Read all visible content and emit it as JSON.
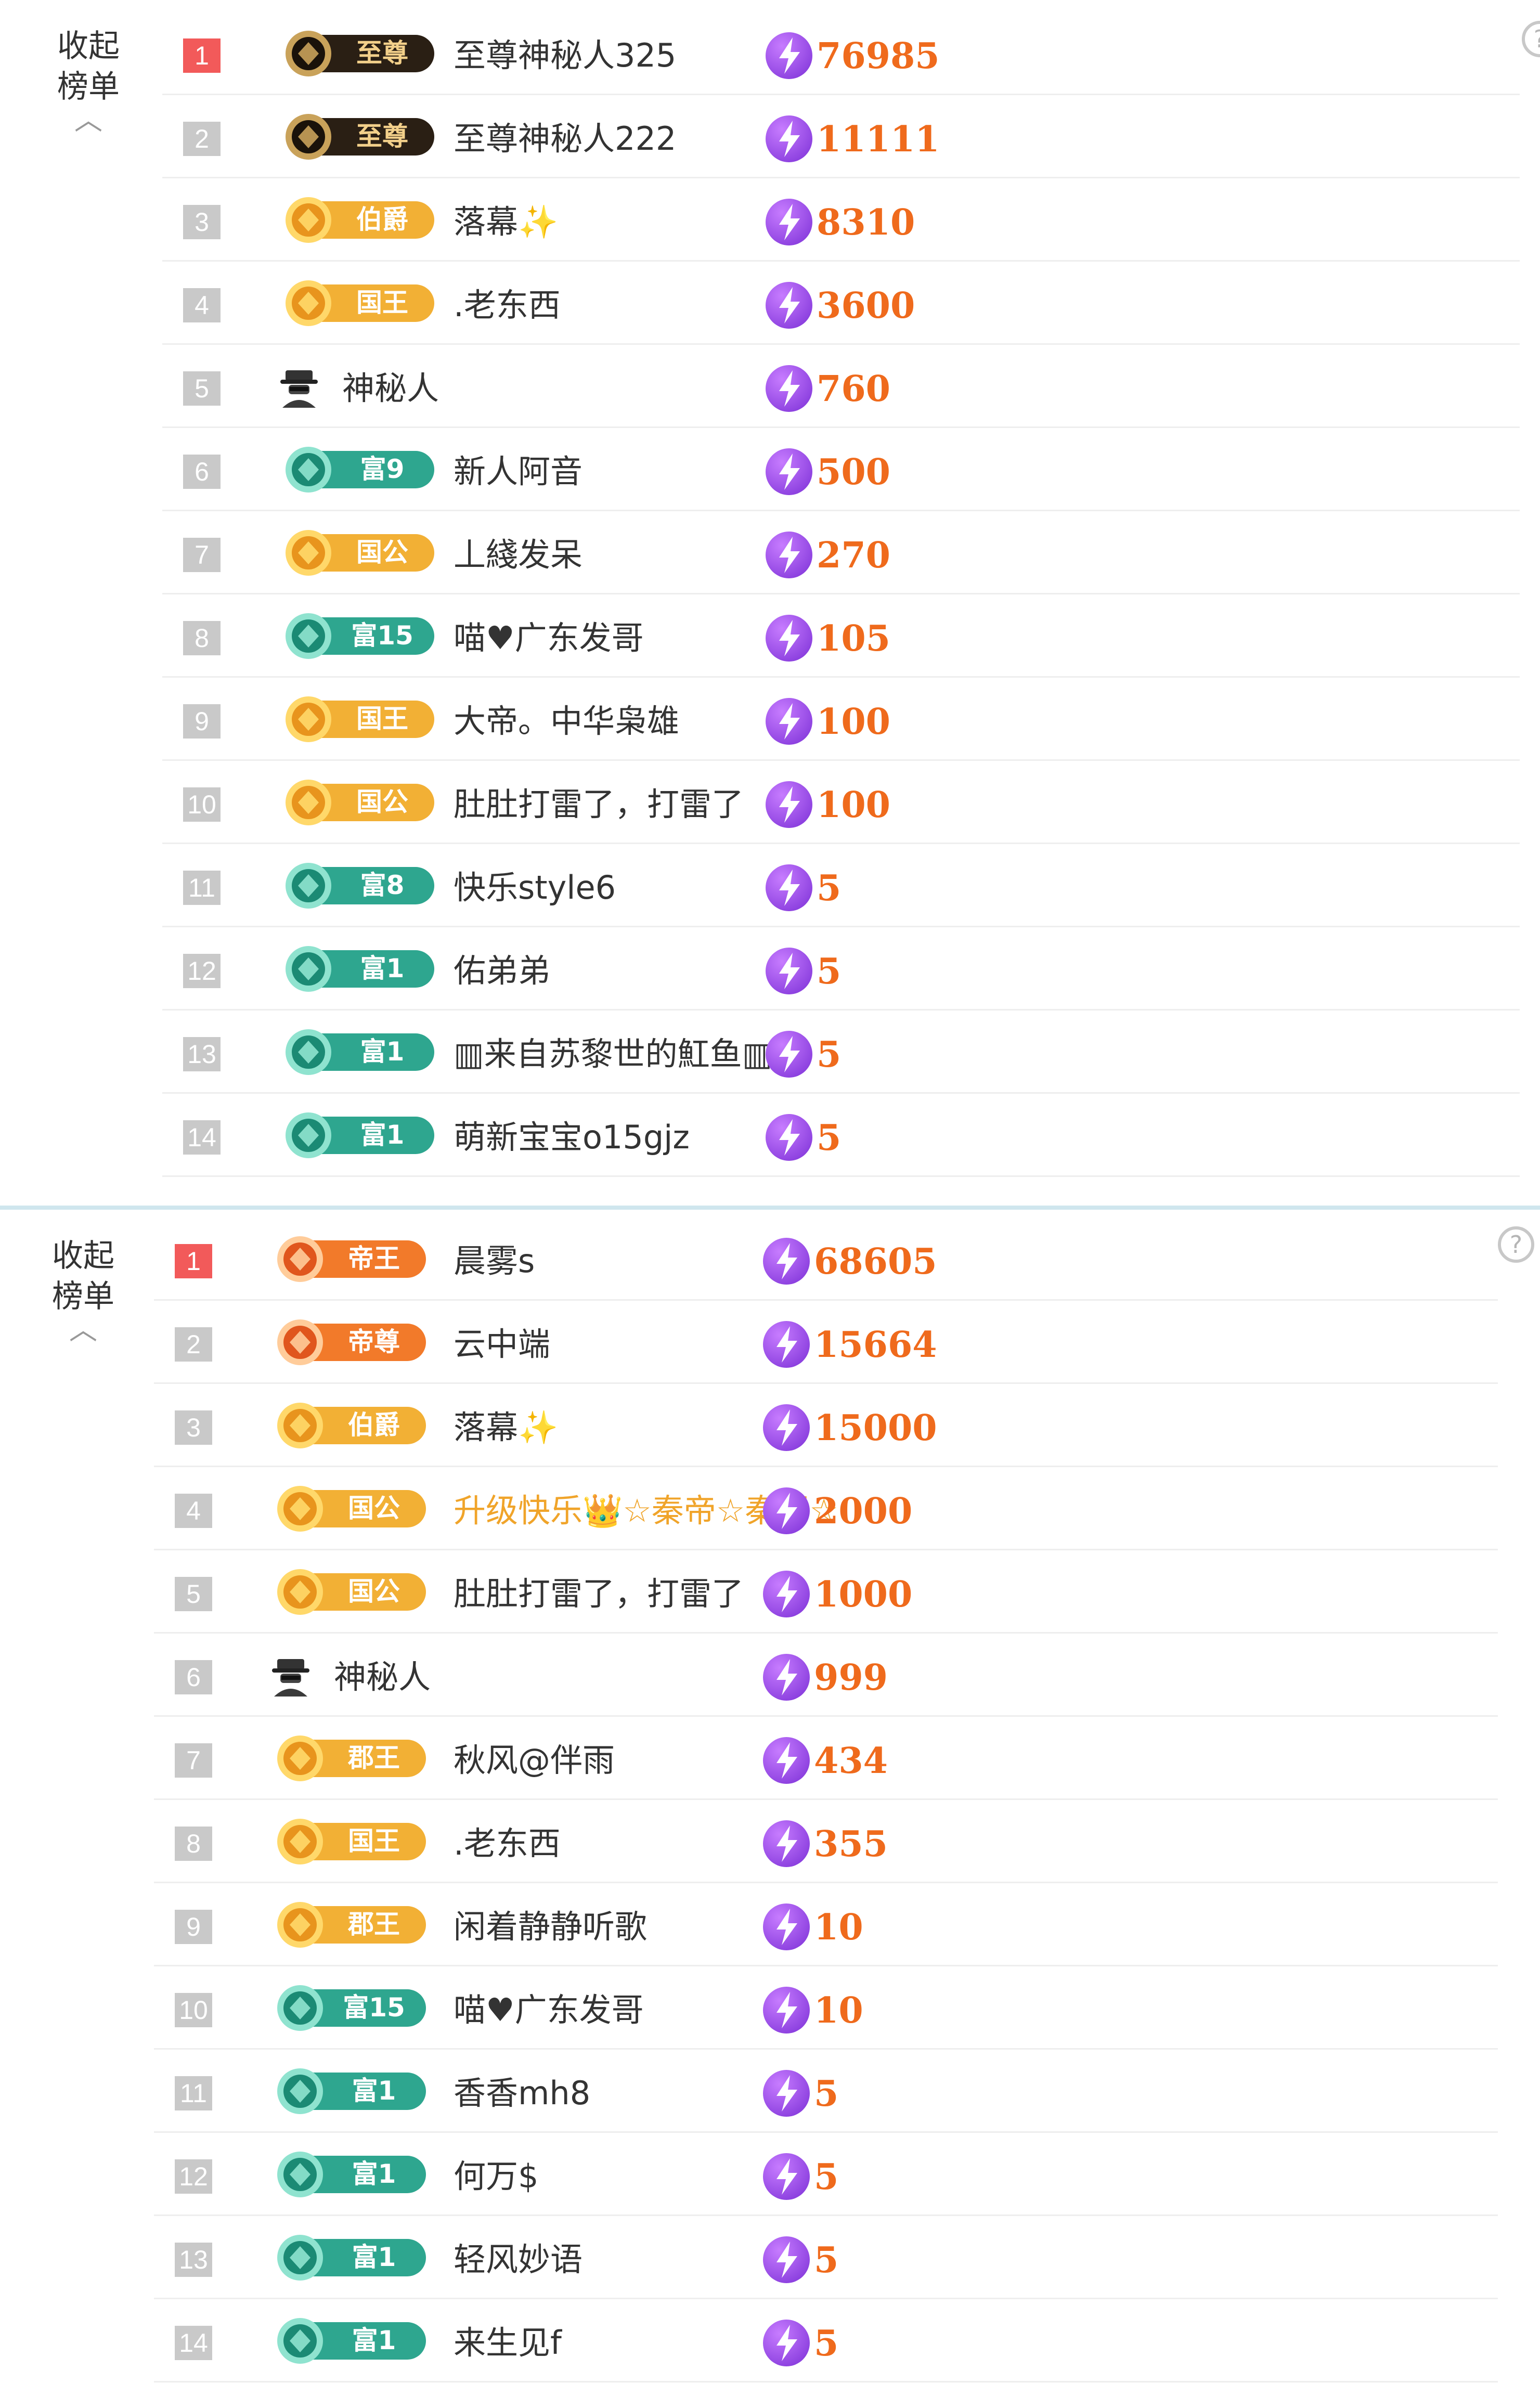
{
  "colors": {
    "accent_score": "#ef6a1c",
    "rank_first": "#f25a5a",
    "rank_other": "#c9c9c9",
    "gold_name": "#f0a42a",
    "separator": "#cfe6ee"
  },
  "panels": [
    {
      "collapse_label": "收起\n榜单",
      "rows": [
        {
          "rank": "1",
          "medal": "至尊",
          "medal_type": "supreme",
          "name": "至尊神秘人325",
          "score": "76985"
        },
        {
          "rank": "2",
          "medal": "至尊",
          "medal_type": "supreme",
          "name": "至尊神秘人222",
          "score": "11111"
        },
        {
          "rank": "3",
          "medal": "伯爵",
          "medal_type": "gold",
          "name": "落幕✨",
          "score": "8310"
        },
        {
          "rank": "4",
          "medal": "国王",
          "medal_type": "gold",
          "name": ".老东西",
          "score": "3600"
        },
        {
          "rank": "5",
          "medal": "",
          "medal_type": "mystery",
          "name": "神秘人",
          "score": "760"
        },
        {
          "rank": "6",
          "medal": "富9",
          "medal_type": "green",
          "name": "新人阿音",
          "score": "500"
        },
        {
          "rank": "7",
          "medal": "国公",
          "medal_type": "gold",
          "name": "丄綫发呆",
          "score": "270"
        },
        {
          "rank": "8",
          "medal": "富15",
          "medal_type": "green",
          "name": "喵♥广东发哥",
          "score": "105"
        },
        {
          "rank": "9",
          "medal": "国王",
          "medal_type": "gold",
          "name": "大帝。中华枭雄",
          "score": "100"
        },
        {
          "rank": "10",
          "medal": "国公",
          "medal_type": "gold",
          "name": "肚肚打雷了，打雷了",
          "score": "100"
        },
        {
          "rank": "11",
          "medal": "富8",
          "medal_type": "green",
          "name": "快乐style6",
          "score": "5"
        },
        {
          "rank": "12",
          "medal": "富1",
          "medal_type": "green",
          "name": "佑弟弟",
          "score": "5"
        },
        {
          "rank": "13",
          "medal": "富1",
          "medal_type": "green",
          "name": "▥来自苏黎世的魟鱼▥",
          "score": "5"
        },
        {
          "rank": "14",
          "medal": "富1",
          "medal_type": "green",
          "name": "萌新宝宝o15gjz",
          "score": "5"
        }
      ]
    },
    {
      "collapse_label": "收起\n榜单",
      "rows": [
        {
          "rank": "1",
          "medal": "帝王",
          "medal_type": "orange",
          "name": "晨雾s",
          "score": "68605"
        },
        {
          "rank": "2",
          "medal": "帝尊",
          "medal_type": "orange",
          "name": "云中端",
          "score": "15664"
        },
        {
          "rank": "3",
          "medal": "伯爵",
          "medal_type": "gold",
          "name": "落幕✨",
          "score": "15000"
        },
        {
          "rank": "4",
          "medal": "国公",
          "medal_type": "gold",
          "name": "升级快乐👑☆秦帝☆秦羽☆",
          "score": "2000",
          "name_style": "gold"
        },
        {
          "rank": "5",
          "medal": "国公",
          "medal_type": "gold",
          "name": "肚肚打雷了，打雷了",
          "score": "1000"
        },
        {
          "rank": "6",
          "medal": "",
          "medal_type": "mystery",
          "name": "神秘人",
          "score": "999"
        },
        {
          "rank": "7",
          "medal": "郡王",
          "medal_type": "gold",
          "name": "秋风@伴雨",
          "score": "434"
        },
        {
          "rank": "8",
          "medal": "国王",
          "medal_type": "gold",
          "name": ".老东西",
          "score": "355"
        },
        {
          "rank": "9",
          "medal": "郡王",
          "medal_type": "gold",
          "name": "闲着静静听歌",
          "score": "10"
        },
        {
          "rank": "10",
          "medal": "富15",
          "medal_type": "green",
          "name": "喵♥广东发哥",
          "score": "10"
        },
        {
          "rank": "11",
          "medal": "富1",
          "medal_type": "green",
          "name": "香香mh8",
          "score": "5"
        },
        {
          "rank": "12",
          "medal": "富1",
          "medal_type": "green",
          "name": "何万$",
          "score": "5"
        },
        {
          "rank": "13",
          "medal": "富1",
          "medal_type": "green",
          "name": "轻风妙语",
          "score": "5"
        },
        {
          "rank": "14",
          "medal": "富1",
          "medal_type": "green",
          "name": "来生见f",
          "score": "5"
        }
      ]
    }
  ],
  "icons": {
    "help": "question-circle-icon",
    "score": "lightning-icon",
    "collapse": "chevron-up-icon"
  },
  "help_glyph": "?"
}
